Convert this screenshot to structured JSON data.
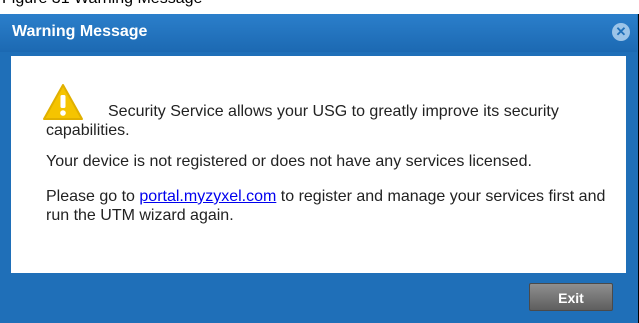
{
  "caption": "Figure 31 Warning Message",
  "dialog": {
    "title": "Warning Message",
    "close_icon": "close-circle-icon",
    "warning_icon": "warning-triangle-icon",
    "message_line_1": "Security Service allows your USG to greatly improve its security capabilities.",
    "message_line_2": "Your device is not registered or does not have any services licensed.",
    "message_line_3_prefix": "Please go to ",
    "message_link": "portal.myzyxel.com",
    "message_line_3_suffix": " to register and manage your services first and run the UTM wizard again.",
    "exit_label": "Exit",
    "colors": {
      "title_bar": "#1f6fb8",
      "warning_yellow": "#f5c400",
      "link": "#0000ee",
      "exit_button": "#6f6f6f"
    }
  }
}
